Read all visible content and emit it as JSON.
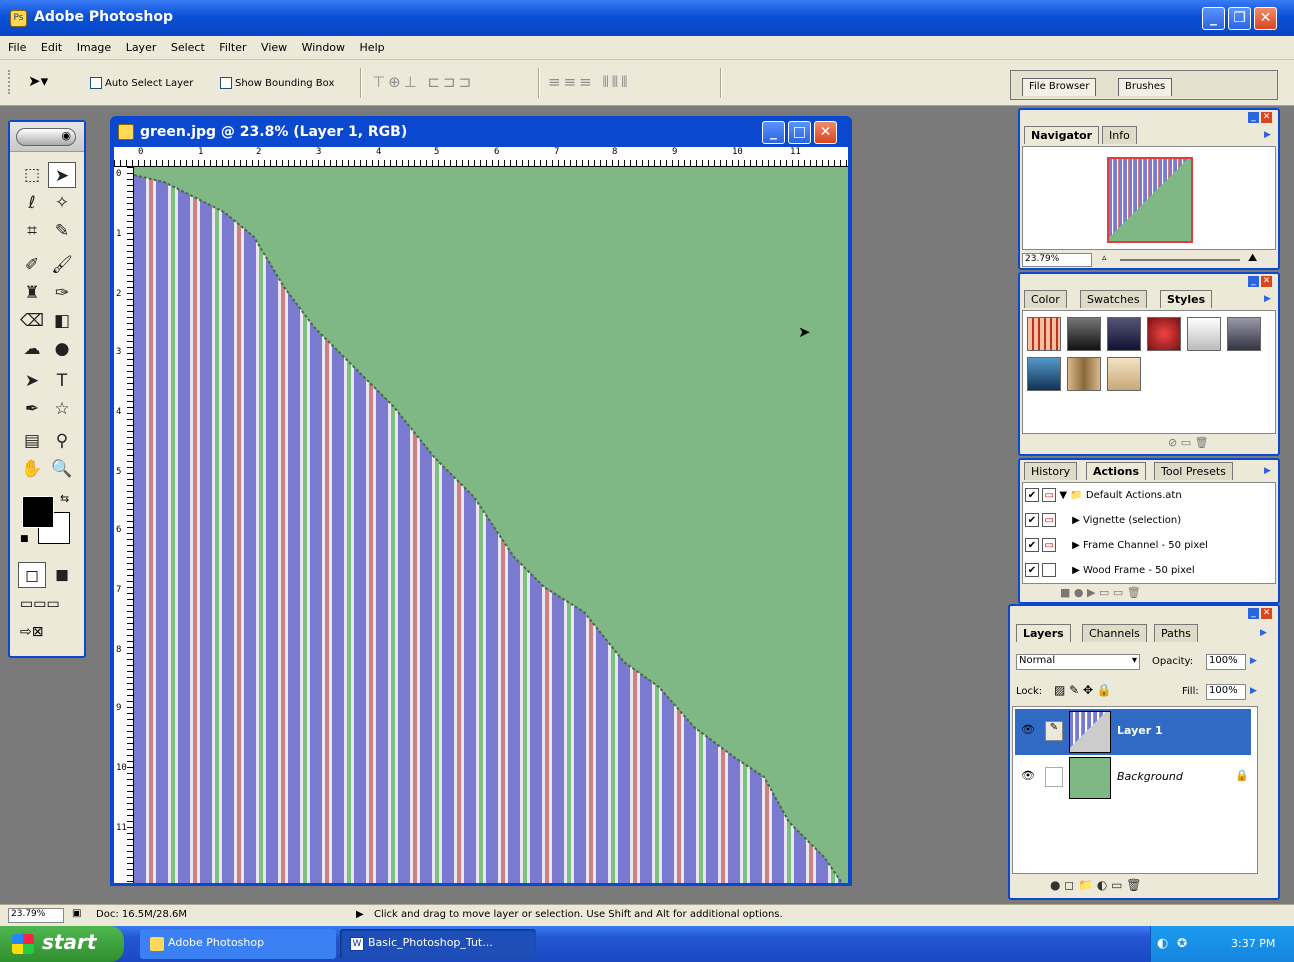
{
  "app": {
    "title": "Adobe Photoshop"
  },
  "menu": [
    "File",
    "Edit",
    "Image",
    "Layer",
    "Select",
    "Filter",
    "View",
    "Window",
    "Help"
  ],
  "options": {
    "auto_select_label": "Auto Select Layer",
    "show_bounding_label": "Show Bounding Box",
    "auto_select_checked": false,
    "show_bounding_checked": false
  },
  "well": {
    "tabs": [
      "File Browser",
      "Brushes"
    ]
  },
  "document": {
    "title": "green.jpg @ 23.8% (Layer 1, RGB)",
    "ruler_top": [
      "0",
      "1",
      "2",
      "3",
      "4",
      "5",
      "6",
      "7",
      "8",
      "9",
      "10",
      "11"
    ],
    "ruler_left": [
      "0",
      "1",
      "2",
      "3",
      "4",
      "5",
      "6",
      "7",
      "8",
      "9",
      "10",
      "11"
    ]
  },
  "navigator": {
    "tabs": [
      "Navigator",
      "Info"
    ],
    "zoom": "23.79%"
  },
  "styles_panel": {
    "tabs": [
      "Color",
      "Swatches",
      "Styles"
    ]
  },
  "actions_panel": {
    "tabs": [
      "History",
      "Actions",
      "Tool Presets"
    ],
    "items": [
      "Default Actions.atn",
      "Vignette (selection)",
      "Frame Channel - 50 pixel",
      "Wood Frame - 50 pixel"
    ]
  },
  "layers_panel": {
    "tabs": [
      "Layers",
      "Channels",
      "Paths"
    ],
    "blend_mode": "Normal",
    "opacity_label": "Opacity:",
    "opacity": "100%",
    "lock_label": "Lock:",
    "fill_label": "Fill:",
    "fill": "100%",
    "layers": [
      "Layer 1",
      "Background"
    ]
  },
  "status": {
    "zoom": "23.79%",
    "doc": "Doc: 16.5M/28.6M",
    "hint": "Click and drag to move layer or selection. Use Shift and Alt for additional options."
  },
  "taskbar": {
    "start": "start",
    "tasks": [
      "Adobe Photoshop",
      "Basic_Photoshop_Tut..."
    ],
    "time": "3:37 PM"
  },
  "colors": {
    "accent": "#0a48d0",
    "canvas_green": "#7fb884",
    "selected_layer": "#316ac5"
  }
}
